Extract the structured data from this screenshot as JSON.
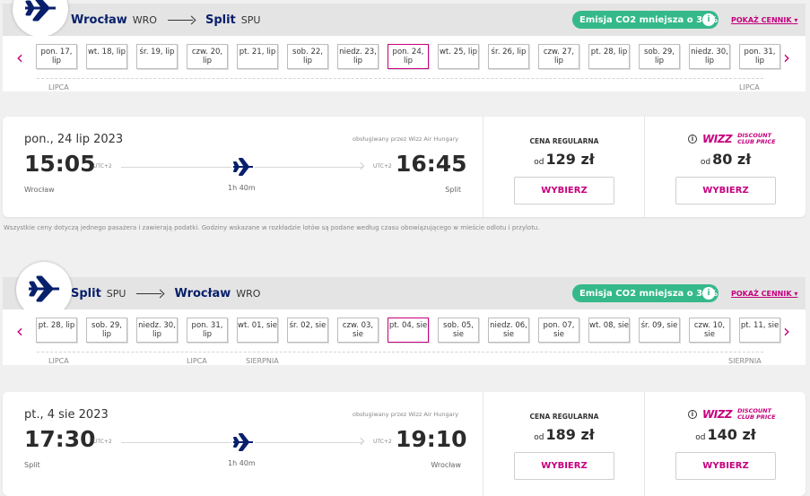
{
  "flight1": {
    "from_city": "Wrocław",
    "from_code": "WRO",
    "to_city": "Split",
    "to_code": "SPU",
    "co2": "Emisja CO2 mniejsza o 33%",
    "show_prices": "POKAŻ CENNIK",
    "days": [
      "pon. 17, lip",
      "wt. 18, lip",
      "śr. 19, lip",
      "czw. 20, lip",
      "pt. 21, lip",
      "sob. 22, lip",
      "niedz. 23, lip",
      "pon. 24, lip",
      "wt. 25, lip",
      "śr. 26, lip",
      "czw. 27, lip",
      "pt. 28, lip",
      "sob. 29, lip",
      "niedz. 30, lip",
      "pon. 31, lip"
    ],
    "selected_index": 7,
    "month_left": "LIPCA",
    "month_right": "LIPCA",
    "date": "pon., 24 lip 2023",
    "operated_by": "obsługiwany przez Wizz Air Hungary",
    "dep_time": "15:05",
    "arr_time": "16:45",
    "utc_dep": "UTC+2",
    "utc_arr": "UTC+2",
    "duration": "1h 40m",
    "dep_city": "Wrocław",
    "arr_city": "Split",
    "regular_title": "CENA REGULARNA",
    "od": "od",
    "regular_price": "129 zł",
    "club_price": "80 zł",
    "select": "WYBIERZ"
  },
  "disclaimer": "Wszystkie ceny dotyczą jednego pasażera i zawierają podatki. Godziny wskazane w rozkładzie lotów są podane według czasu obowiązującego w mieście odlotu i przylotu.",
  "club": {
    "brand": "WIZZ",
    "line1": "DISCOUNT",
    "line2": "CLUB PRICE",
    "info": "i"
  },
  "flight2": {
    "from_city": "Split",
    "from_code": "SPU",
    "to_city": "Wrocław",
    "to_code": "WRO",
    "co2": "Emisja CO2 mniejsza o 33%",
    "show_prices": "POKAŻ CENNIK",
    "days": [
      "pt. 28, lip",
      "sob. 29, lip",
      "niedz. 30, lip",
      "pon. 31, lip",
      "wt. 01, sie",
      "śr. 02, sie",
      "czw. 03, sie",
      "pt. 04, sie",
      "sob. 05, sie",
      "niedz. 06, sie",
      "pon. 07, sie",
      "wt. 08, sie",
      "śr. 09, sie",
      "czw. 10, sie",
      "pt. 11, sie"
    ],
    "selected_index": 7,
    "month_a": "LIPCA",
    "month_b": "LIPCA",
    "month_c": "SIERPNIA",
    "month_d": "SIERPNIA",
    "date": "pt., 4 sie 2023",
    "operated_by": "obsługiwany przez Wizz Air Hungary",
    "dep_time": "17:30",
    "arr_time": "19:10",
    "utc_dep": "UTC+2",
    "utc_arr": "UTC+2",
    "duration": "1h 40m",
    "dep_city": "Split",
    "arr_city": "Wrocław",
    "regular_title": "CENA REGULARNA",
    "od": "od",
    "regular_price": "189 zł",
    "club_price": "140 zł",
    "select": "WYBIERZ"
  },
  "colors": {
    "accent": "#c6007e",
    "navy": "#08206b",
    "co2": "#35b98a"
  },
  "icons": {
    "logo": "plane-icon",
    "prev": "chevron-left-icon",
    "next": "chevron-right-icon",
    "info": "info-icon"
  }
}
